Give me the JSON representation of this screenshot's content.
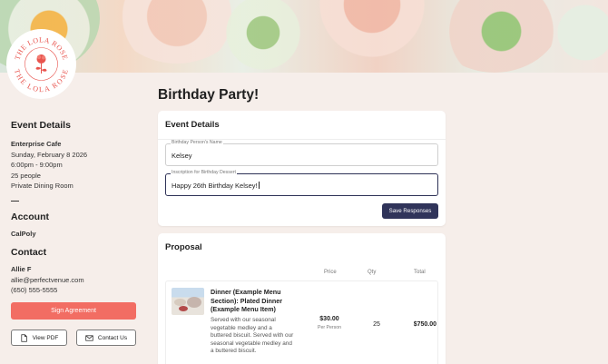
{
  "brand": {
    "logo_text_top": "THE LOLA ROSE",
    "logo_text_bottom": "THE LOLA ROSE"
  },
  "page": {
    "title": "Birthday Party!"
  },
  "sidebar": {
    "event_heading": "Event Details",
    "venue": "Enterprise Cafe",
    "date": "Sunday, February 8 2026",
    "time": "6:00pm - 9:00pm",
    "guests": "25 people",
    "room": "Private Dining Room",
    "account_heading": "Account",
    "account_name": "CalPoly",
    "contact_heading": "Contact",
    "contact_name": "Allie F",
    "contact_email": "allie@perfectvenue.com",
    "contact_phone": "(650) 555-5555",
    "sign_button": "Sign Agreement",
    "pdf_button": "View PDF",
    "contact_button": "Contact Us"
  },
  "event_card": {
    "title": "Event Details",
    "field1": {
      "label": "Birthday Person's Name",
      "value": "Kelsey"
    },
    "field2": {
      "label": "Inscription for Birthday Dessert",
      "value": "Happy 26th Birthday Kelsey!"
    },
    "save_button": "Save Responses"
  },
  "proposal": {
    "title": "Proposal",
    "columns": {
      "price": "Price",
      "qty": "Qty",
      "total": "Total"
    },
    "item": {
      "name": "Dinner (Example Menu Section): Plated Dinner (Example Menu Item)",
      "description": "Served with our seasonal vegetable medley and a buttered biscuit. Served with our seasonal vegetable medley and a buttered biscuit.",
      "price": "$30.00",
      "unit": "Per Person",
      "qty": "25",
      "total": "$750.00"
    }
  },
  "colors": {
    "accent": "#f26d63",
    "primary": "#30345a",
    "background": "#f6eeea",
    "logo_red": "#e8544e"
  }
}
